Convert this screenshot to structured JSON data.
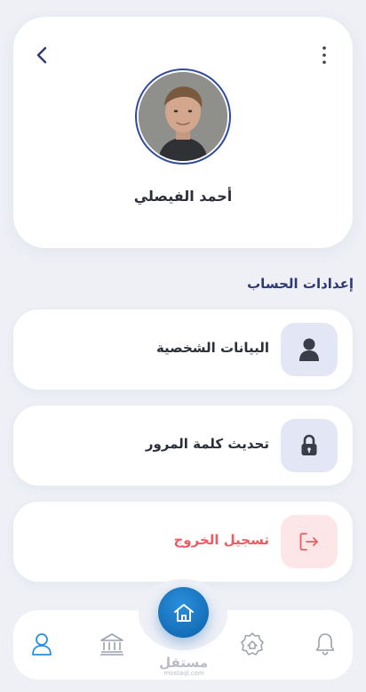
{
  "profile": {
    "name": "أحمد الفيصلي",
    "back_icon": "chevron-left-icon",
    "more_icon": "more-vertical-icon"
  },
  "settings": {
    "title": "إعدادات الحساب",
    "items": [
      {
        "label": "البيانات الشخصية",
        "icon": "user-icon",
        "label_color": "#2c2f3a",
        "icon_bg": "#e3e6f4"
      },
      {
        "label": "تحديث كلمة المرور",
        "icon": "lock-icon",
        "label_color": "#2c2f3a",
        "icon_bg": "#e3e6f4"
      },
      {
        "label": "تسجيل الخروج",
        "icon": "logout-icon",
        "label_color": "#ef5b63",
        "icon_bg": "#fde6e8"
      }
    ]
  },
  "bottom_nav": {
    "items": [
      "profile-icon",
      "bank-icon",
      "home-icon",
      "badge-settings-icon",
      "bell-icon"
    ],
    "active_color": "#2a8fdc",
    "inactive_color": "#9aa0ad"
  },
  "watermark": {
    "arabic": "مستقل",
    "latin": "mostaql.com"
  },
  "colors": {
    "accent": "#156fb8",
    "background": "#eef0f6",
    "danger": "#ef5b63"
  }
}
